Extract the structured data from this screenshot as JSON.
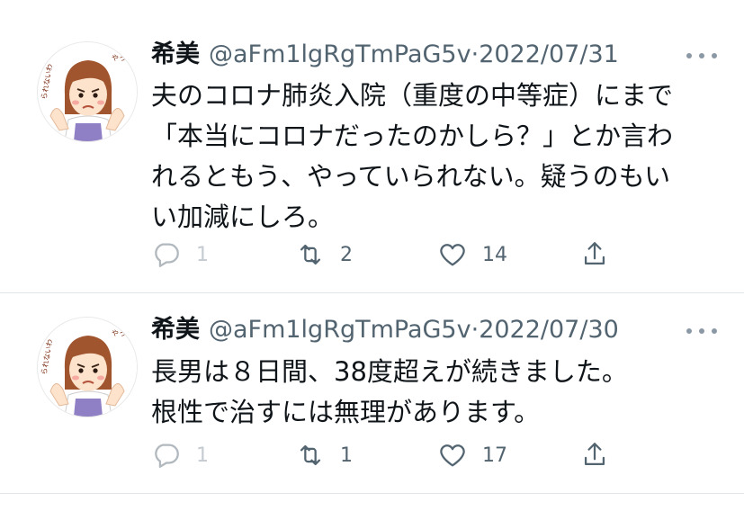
{
  "tweets": [
    {
      "name": "希美",
      "handle": "@aFm1lgRgTmPaG5v",
      "date": "2022/07/31",
      "text_lines": [
        "夫のコロナ肺炎入院（重度の中等症）にまで",
        "「本当にコロナだったのかしら？」とか言わ",
        "れるともう、やっていられない。疑うのもい",
        "い加減にしろ。"
      ],
      "reply_count": "1",
      "retweet_count": "2",
      "like_count": "14"
    },
    {
      "name": "希美",
      "handle": "@aFm1lgRgTmPaG5v",
      "date": "2022/07/30",
      "text_lines": [
        "長男は８日間、38度超えが続きました。",
        "根性で治すには無理があります。"
      ],
      "reply_count": "1",
      "retweet_count": "1",
      "like_count": "17"
    }
  ],
  "separator": "·",
  "icons": {
    "reply": "reply-bubble-icon",
    "retweet": "retweet-arrows-icon",
    "like": "heart-outline-icon",
    "share": "share-upload-icon",
    "more": "more-dots-icon"
  },
  "colors": {
    "text": "#0f1419",
    "secondary": "#536471",
    "divider": "#e1e6ea"
  }
}
